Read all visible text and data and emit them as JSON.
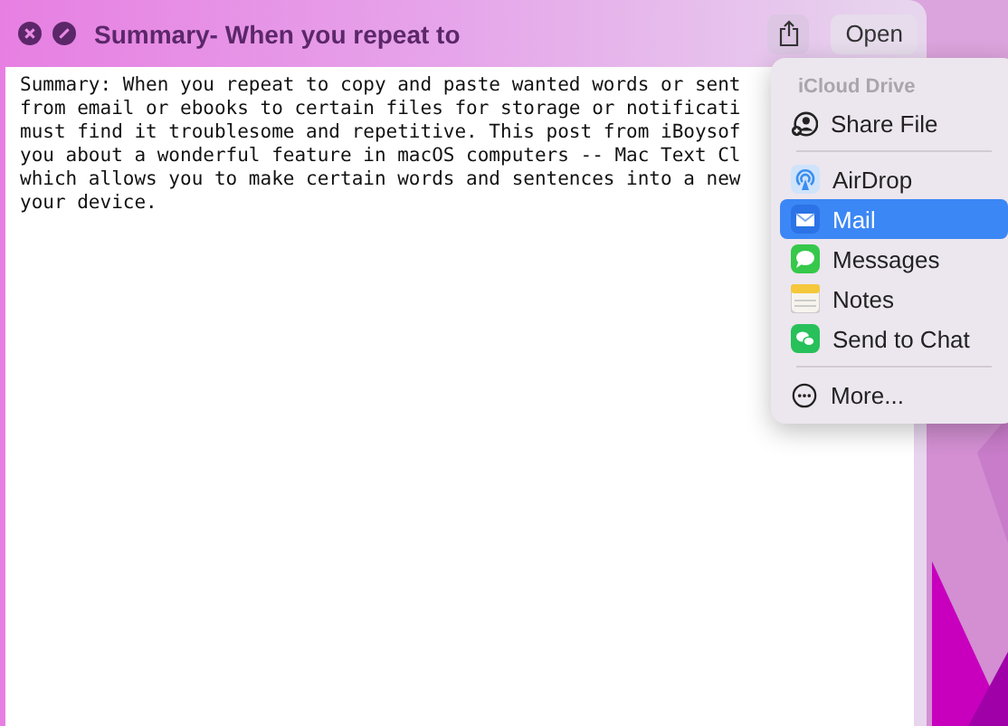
{
  "window": {
    "title": "Summary- When you repeat to"
  },
  "toolbar": {
    "open_button": "Open"
  },
  "document": {
    "lines": [
      "Summary: When you repeat to copy and paste wanted words or sent",
      "from email or ebooks to certain files for storage or notificati",
      "must find it troublesome and repetitive. This post from iBoysof",
      "you about a wonderful feature in macOS computers -- Mac Text Cl",
      "which allows you to make certain words and sentences into a new",
      "your device."
    ]
  },
  "share_menu": {
    "sections": [
      {
        "header": "iCloud Drive",
        "items": [
          {
            "kind": "share",
            "label": "Share File",
            "selected": false
          }
        ]
      },
      {
        "items": [
          {
            "kind": "airdrop",
            "label": "AirDrop",
            "selected": false
          },
          {
            "kind": "mail",
            "label": "Mail",
            "selected": true
          },
          {
            "kind": "messages",
            "label": "Messages",
            "selected": false
          },
          {
            "kind": "notes",
            "label": "Notes",
            "selected": false
          },
          {
            "kind": "chat",
            "label": "Send to Chat",
            "selected": false
          }
        ]
      },
      {
        "items": [
          {
            "kind": "more",
            "label": "More...",
            "selected": false
          }
        ]
      }
    ]
  }
}
